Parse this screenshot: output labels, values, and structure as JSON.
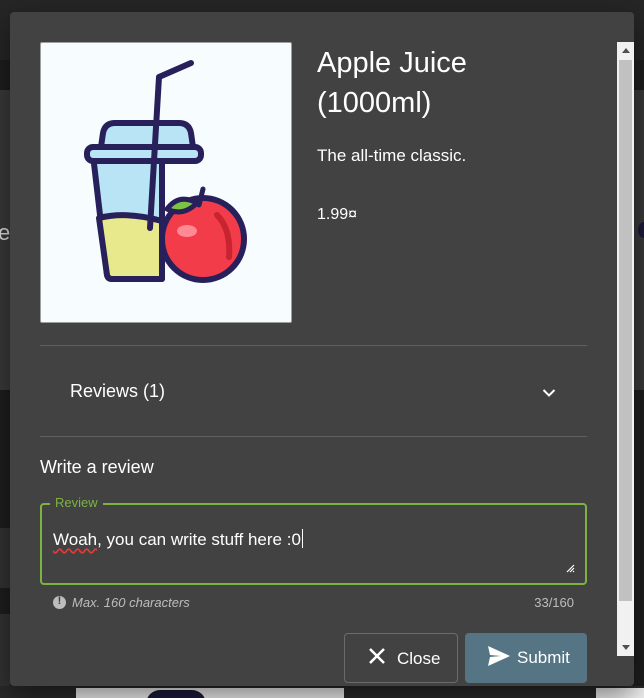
{
  "product": {
    "title": "Apple Juice (1000ml)",
    "description": "The all-time classic.",
    "price": "1.99¤",
    "image_icon": "juice-cup-with-apple"
  },
  "reviews": {
    "header_label": "Reviews (1)",
    "expanded": false
  },
  "write_review": {
    "heading": "Write a review",
    "field_label": "Review",
    "value_misspelled_word": "Woah",
    "value_rest": ", you can write stuff here :0",
    "hint": "Max. 160 characters",
    "counter": "33/160"
  },
  "buttons": {
    "close_label": "Close",
    "submit_label": "Submit"
  },
  "colors": {
    "dialog_bg": "#424242",
    "accent_green": "#7cb342",
    "submit_bg": "#557585"
  }
}
